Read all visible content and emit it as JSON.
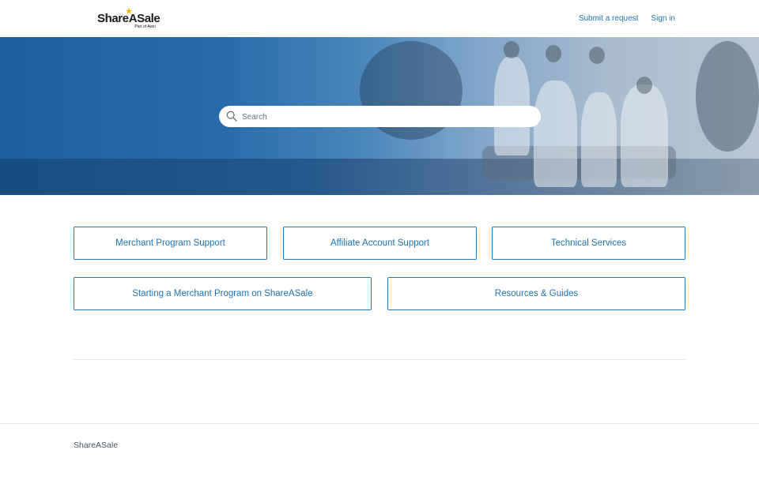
{
  "header": {
    "logo_text": "ShareASale",
    "logo_subtext": "Part of Awin",
    "nav": {
      "submit_request": "Submit a request",
      "sign_in": "Sign in"
    }
  },
  "hero": {
    "search": {
      "placeholder": "Search",
      "value": ""
    }
  },
  "blocks": [
    {
      "label": "Merchant Program Support"
    },
    {
      "label": "Affiliate Account Support"
    },
    {
      "label": "Technical Services"
    },
    {
      "label": "Starting a Merchant Program on ShareASale"
    },
    {
      "label": "Resources & Guides"
    }
  ],
  "footer": {
    "brand": "ShareASale"
  },
  "colors": {
    "link": "#1f73b7",
    "logo_star": "#f5b400"
  },
  "icons": {
    "search": "search-icon",
    "logo_star": "star-icon"
  }
}
